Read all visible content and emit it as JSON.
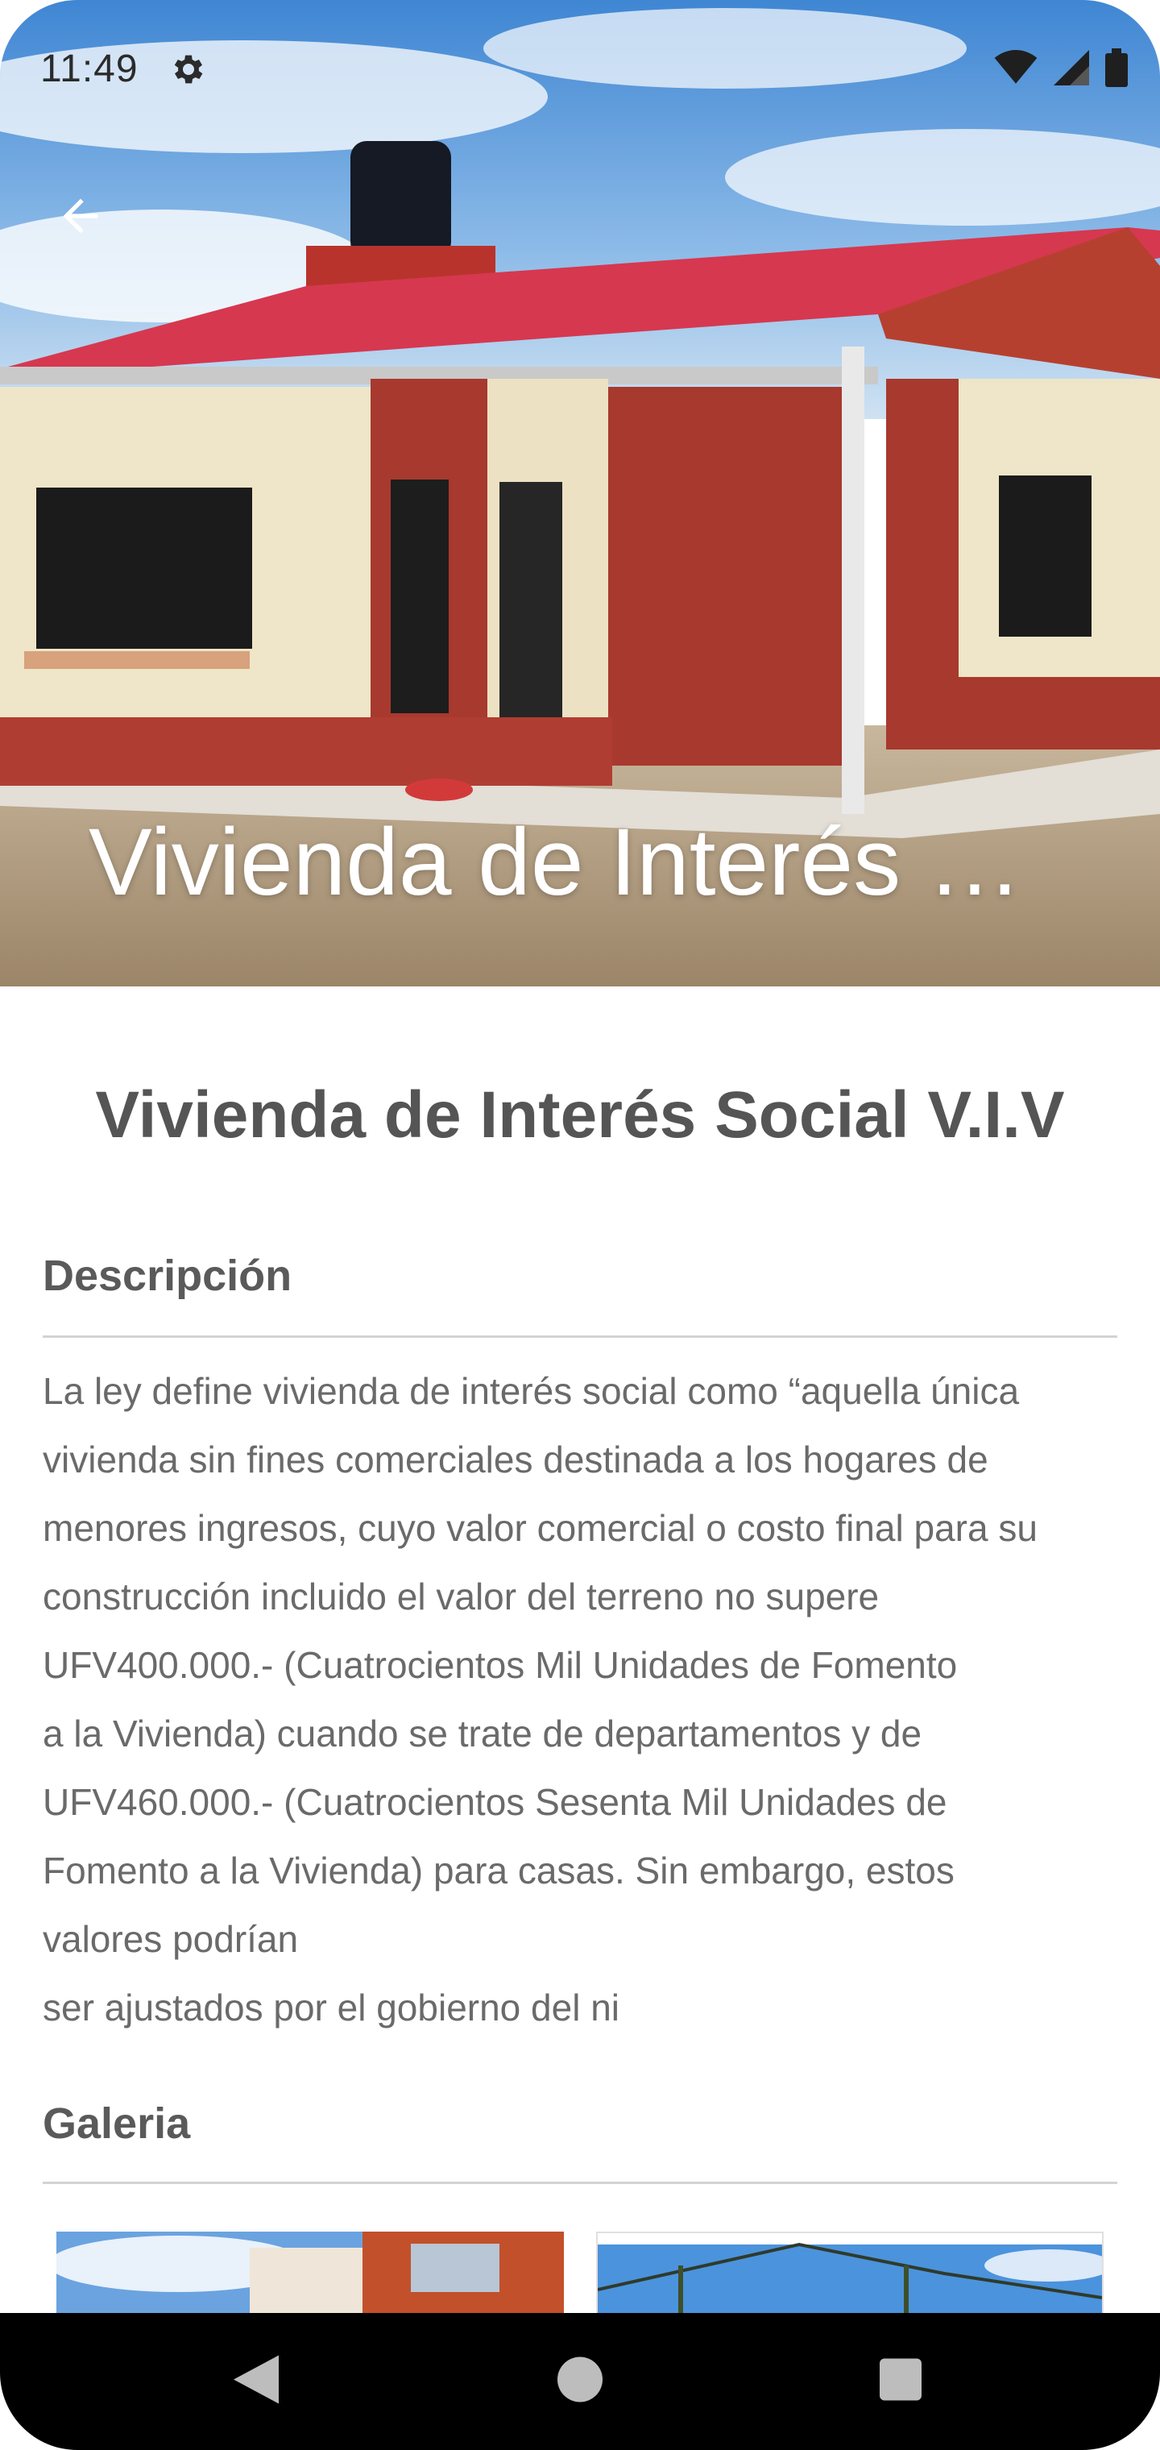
{
  "status_bar": {
    "time": "11:49",
    "icons": [
      "settings-gear-icon",
      "wifi-icon",
      "signal-icon",
      "battery-icon"
    ]
  },
  "header": {
    "back_icon": "arrow-left-icon",
    "hero_title": "Vivienda de Interés S…"
  },
  "main": {
    "title": "Vivienda de Interés Social V.I.V",
    "description": {
      "heading": "Descripción",
      "text": "La ley define vivienda de interés social como “aquella única\nvivienda sin fines comerciales destinada a los hogares de\nmenores ingresos, cuyo valor comercial o costo final para su\nconstrucción incluido el valor del terreno no supere\nUFV400.000.- (Cuatrocientos Mil Unidades de  Fomento\na la Vivienda) cuando se trate de departamentos y de\nUFV460.000.- (Cuatrocientos  Sesenta Mil Unidades de\nFomento a la Vivienda) para casas. Sin embargo, estos\nvalores podrían\nser ajustados por el gobierno del ni"
    },
    "gallery": {
      "heading": "Galeria"
    }
  },
  "nav_bar": {
    "icons": [
      "back-triangle-icon",
      "home-circle-icon",
      "recents-square-icon"
    ]
  },
  "colors": {
    "roof": "#d63850",
    "wall_red": "#a8392e",
    "wall_cream": "#efe5c8",
    "text_primary": "#555555",
    "text_body": "#6a6a6a"
  }
}
